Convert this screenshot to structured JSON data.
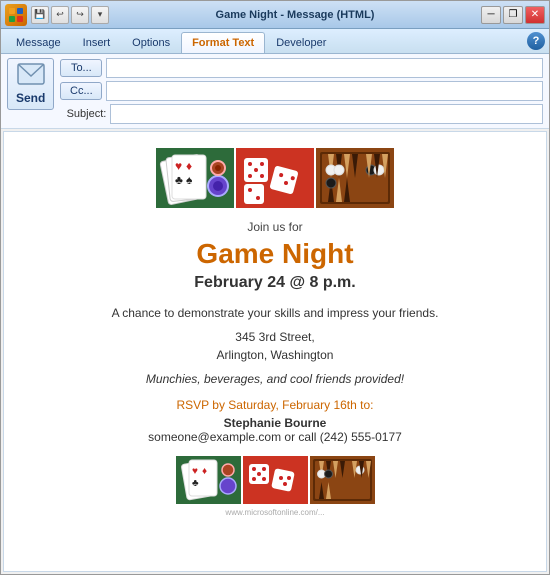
{
  "window": {
    "title": "Game Night - Message (HTML)",
    "min_label": "─",
    "restore_label": "❐",
    "close_label": "✕"
  },
  "ribbon": {
    "tabs": [
      {
        "id": "message",
        "label": "Message",
        "active": false
      },
      {
        "id": "insert",
        "label": "Insert",
        "active": false
      },
      {
        "id": "options",
        "label": "Options",
        "active": false
      },
      {
        "id": "format-text",
        "label": "Format Text",
        "active": true
      },
      {
        "id": "developer",
        "label": "Developer",
        "active": false
      }
    ]
  },
  "email": {
    "to_label": "To...",
    "cc_label": "Cc...",
    "subject_label": "Subject:",
    "send_label": "Send",
    "to_value": "",
    "cc_value": "",
    "subject_value": ""
  },
  "content": {
    "join_us": "Join us for",
    "title": "Game Night",
    "date": "February 24 @ 8 p.m.",
    "description": "A chance to demonstrate your skills and impress your friends.",
    "address_line1": "345 3rd Street,",
    "address_line2": "Arlington, Washington",
    "munchies": "Munchies, beverages, and cool friends provided!",
    "rsvp": "RSVP by Saturday, February 16th to:",
    "name": "Stephanie Bourne",
    "contact": "someone@example.com or call (242) 555-0177",
    "watermark": "www.microsoftonline.com/..."
  },
  "colors": {
    "title": "#cc6600",
    "rsvp": "#cc6600",
    "background": "#f0f8ff"
  }
}
